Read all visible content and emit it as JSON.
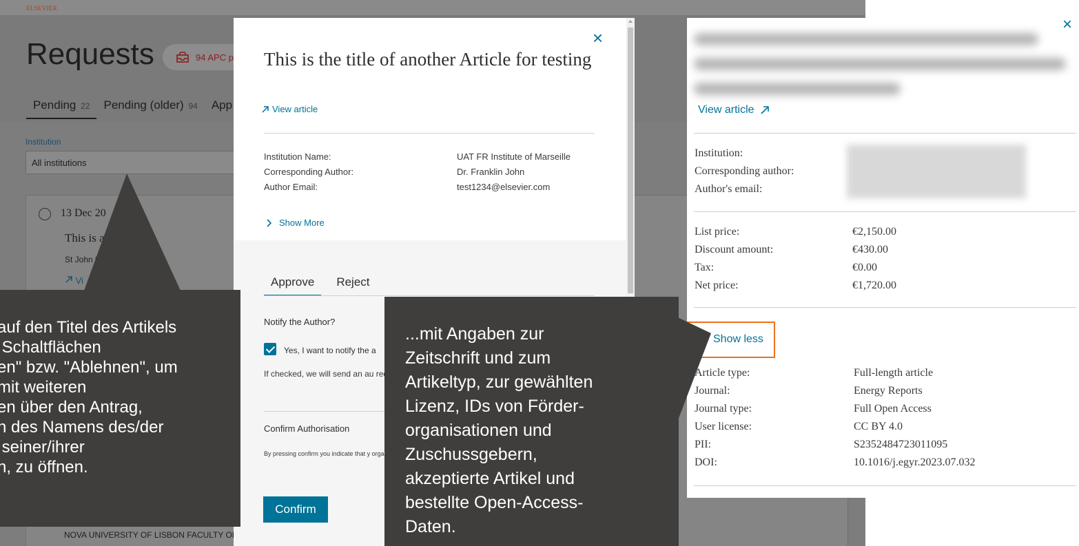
{
  "background": {
    "logo": "ELSEVIER",
    "page_title": "Requests",
    "apc_badge": "94 APC p",
    "tabs": [
      {
        "label": "Pending",
        "count": "22"
      },
      {
        "label": "Pending (older)",
        "count": "94"
      },
      {
        "label": "App",
        "count": ""
      }
    ],
    "institution_label": "Institution",
    "institution_value": "All institutions",
    "card": {
      "date": "13 Dec 20",
      "title": "This is          article title.",
      "affiliation": "St John                    f john Smith Oli",
      "link": "Vi"
    },
    "bottom_text": "NOVA UNIVERSITY OF LISBON FACULTY OF SCIENCES AND TECHNOLOGY"
  },
  "dialog": {
    "close_label": "×",
    "title": "This is the title of another Article for testing",
    "view_article": "View article",
    "fields": [
      {
        "label": "Institution Name:",
        "value": "UAT FR Institute of Marseille"
      },
      {
        "label": "Corresponding Author:",
        "value": "Dr. Franklin John"
      },
      {
        "label": "Author Email:",
        "value": "test1234@elsevier.com"
      }
    ],
    "show_more": "Show More",
    "tabs": [
      "Approve",
      "Reject"
    ],
    "notify_label": "Notify the Author?",
    "notify_checkbox": "Yes, I want to notify the a",
    "notify_info": "If checked, we will send an au request has been approved.",
    "confirm_heading": "Confirm Authorisation",
    "legal_text": "By pressing confirm you indicate that y organization identified in the APC confi terms and conditions in the concurrent",
    "confirm_button": "Confirm"
  },
  "callouts": {
    "left": "auf den Titel des Artikels\n Schaltflächen\nen\" bzw. \"Ablehnen\", um\nmit weiteren\nen über den Antrag,\nh des Namens des/der\n seiner/ihrer\nn, zu öffnen.",
    "right": "...mit Angaben zur\nZeitschrift und zum\nArtikeltyp, zur gewählten\nLizenz, IDs von Förder-\norganisationen und\nZuschussgebern,\nakzeptierte Artikel und\nbestellte Open-Access-\nDaten."
  },
  "panel": {
    "close_label": "×",
    "view_article": "View article",
    "contact_labels": [
      "Institution:",
      "Corresponding author:",
      "Author's email:"
    ],
    "pricing": [
      {
        "label": "List price:",
        "value": "€2,150.00"
      },
      {
        "label": "Discount amount:",
        "value": "€430.00"
      },
      {
        "label": "Tax:",
        "value": "€0.00"
      },
      {
        "label": "Net price:",
        "value": "€1,720.00"
      }
    ],
    "show_less": "Show less",
    "details": [
      {
        "label": "Article type:",
        "value": "Full-length article"
      },
      {
        "label": "Journal:",
        "value": "Energy Reports"
      },
      {
        "label": "Journal type:",
        "value": "Full Open Access"
      },
      {
        "label": "User license:",
        "value": "CC BY 4.0"
      },
      {
        "label": "PII:",
        "value": "S2352484723011095"
      },
      {
        "label": "DOI:",
        "value": "10.1016/j.egyr.2023.07.032"
      }
    ]
  },
  "colors": {
    "accent": "#007398",
    "highlight_border": "#e9711c",
    "callout_bg": "#3f3e3c",
    "overlay_bg": "#7d7d7d"
  }
}
